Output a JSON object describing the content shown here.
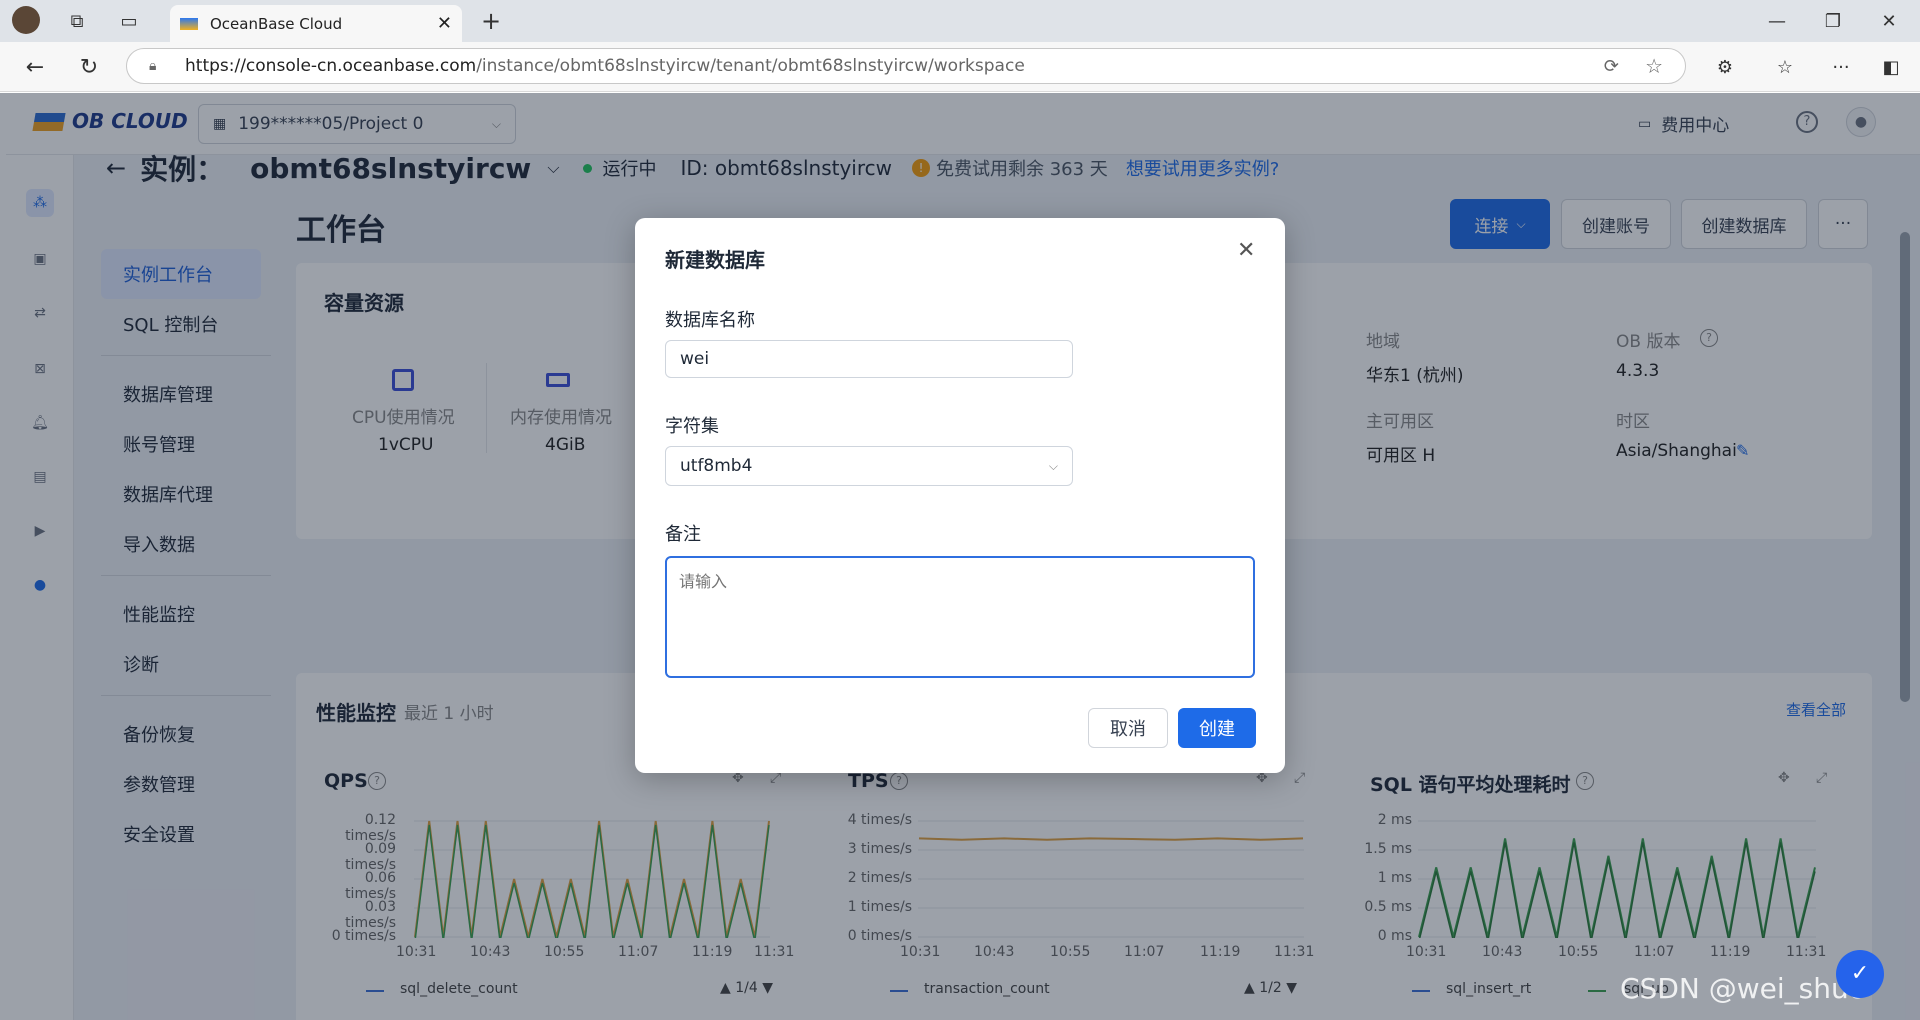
{
  "browser": {
    "tab_title": "OceanBase Cloud",
    "url_host": "https://console-cn.oceanbase.com",
    "url_path": "/instance/obmt68slnstyircw/tenant/obmt68slnstyircw/workspace"
  },
  "topnav": {
    "brand": "OB CLOUD",
    "project": "199******05/Project 0",
    "billing": "费用中心"
  },
  "header": {
    "prefix": "实例：",
    "instance_name": "obmt68slnstyircw",
    "status": "运行中",
    "id_text": "ID: obmt68slnstyircw",
    "trial_text": "免费试用剩余 363 天",
    "more_link": "想要试用更多实例?"
  },
  "subnav": {
    "items": [
      "实例工作台",
      "SQL 控制台",
      "数据库管理",
      "账号管理",
      "数据库代理",
      "导入数据",
      "性能监控",
      "诊断",
      "备份恢复",
      "参数管理",
      "安全设置"
    ]
  },
  "page": {
    "title": "工作台",
    "actions": {
      "connect": "连接",
      "create_account": "创建账号",
      "create_db": "创建数据库",
      "more": "···"
    }
  },
  "capacity": {
    "title": "容量资源",
    "cpu_label": "CPU使用情况",
    "cpu_value": "1vCPU",
    "mem_label": "内存使用情况",
    "mem_value": "4GiB",
    "region_label": "地域",
    "region_value": "华东1 (杭州)",
    "version_label": "OB 版本",
    "version_value": "4.3.3",
    "zone_label": "主可用区",
    "zone_value": "可用区 H",
    "tz_label": "时区",
    "tz_value": "Asia/Shanghai"
  },
  "perf": {
    "title": "性能监控",
    "range": "最近 1 小时",
    "view_all": "查看全部",
    "charts": [
      {
        "title": "QPS",
        "yticks": [
          "0.12 times/s",
          "0.09 times/s",
          "0.06 times/s",
          "0.03 times/s",
          "0 times/s"
        ],
        "legend": "sql_delete_count",
        "pager": "1/4"
      },
      {
        "title": "TPS",
        "yticks": [
          "4 times/s",
          "3 times/s",
          "2 times/s",
          "1 times/s",
          "0 times/s"
        ],
        "legend": "transaction_count",
        "pager": "1/2"
      },
      {
        "title": "SQL 语句平均处理耗时",
        "yticks": [
          "2 ms",
          "1.5 ms",
          "1 ms",
          "0.5 ms",
          "0 ms"
        ],
        "legend": "sql_insert_rt",
        "legend2": "sql_up",
        "pager": ""
      }
    ],
    "xticks": [
      "10:31",
      "10:43",
      "10:55",
      "11:07",
      "11:19",
      "11:31"
    ]
  },
  "chart_data": [
    {
      "type": "line",
      "title": "QPS",
      "ylim": [
        0,
        0.12
      ],
      "series": [
        {
          "name": "sql_delete_count",
          "values": [
            0,
            0.12,
            0,
            0.12,
            0,
            0.12,
            0,
            0.06,
            0,
            0.06,
            0,
            0.06,
            0,
            0.12,
            0,
            0.06,
            0,
            0.12,
            0,
            0.06,
            0,
            0.12,
            0,
            0.06,
            0,
            0.12
          ]
        }
      ]
    },
    {
      "type": "line",
      "title": "TPS",
      "ylim": [
        0,
        4
      ],
      "series": [
        {
          "name": "transaction_count",
          "values": [
            3.4,
            3.35,
            3.4,
            3.35,
            3.4,
            3.38,
            3.35,
            3.4,
            3.35,
            3.4
          ]
        }
      ]
    },
    {
      "type": "line",
      "title": "SQL 语句平均处理耗时",
      "ylim": [
        0,
        2
      ],
      "series": [
        {
          "name": "sql_insert_rt",
          "values": [
            0,
            1.2,
            0,
            1.2,
            0,
            1.7,
            0,
            1.2,
            0,
            1.7,
            0,
            1.4,
            0,
            1.7,
            0,
            1.2,
            0,
            1.4,
            0,
            1.7,
            0,
            1.7,
            0,
            1.2
          ]
        }
      ]
    }
  ],
  "modal": {
    "title": "新建数据库",
    "name_label": "数据库名称",
    "name_value": "wei",
    "charset_label": "字符集",
    "charset_value": "utf8mb4",
    "remark_label": "备注",
    "remark_placeholder": "请输入",
    "cancel": "取消",
    "create": "创建"
  },
  "watermark": "CSDN @wei_shuo",
  "colors": {
    "primary": "#1e6be8",
    "running": "#22c55e",
    "line_orange": "#e0a040",
    "line_green": "#3ca050"
  }
}
